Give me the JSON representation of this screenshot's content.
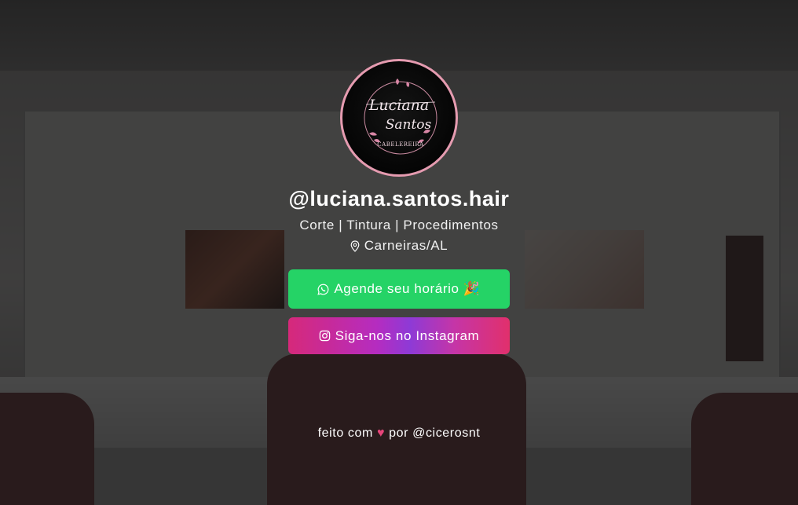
{
  "profile": {
    "username": "@luciana.santos.hair",
    "tagline": "Corte | Tintura | Procedimentos",
    "location": "Carneiras/AL",
    "logo_text": {
      "line1": "Luciana",
      "line2": "Santos",
      "line3": "CABELEREIRA"
    }
  },
  "buttons": {
    "whatsapp": {
      "label": "Agende seu horário 🎉",
      "icon": "whatsapp-icon",
      "color": "#25d366"
    },
    "instagram": {
      "label": "Siga-nos no Instagram",
      "icon": "instagram-icon",
      "color": "#c13584"
    }
  },
  "footer": {
    "prefix": "feito com",
    "heart": "♥",
    "suffix": "por @cicerosnt"
  },
  "colors": {
    "avatar_border": "#e59bb0",
    "heart": "#e8457a",
    "overlay": "rgba(15,15,15,0.72)"
  }
}
